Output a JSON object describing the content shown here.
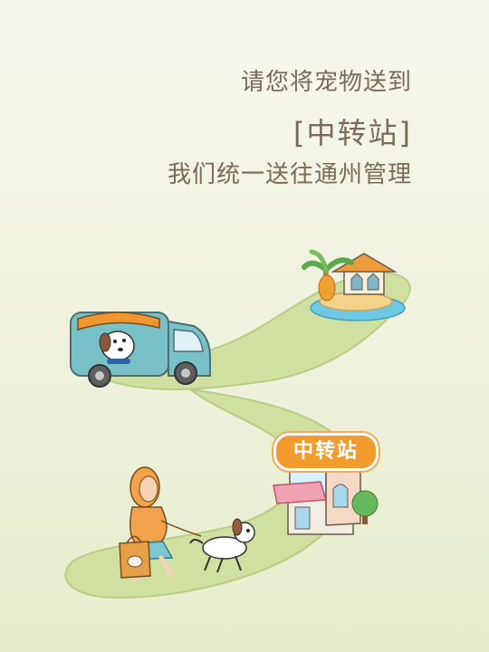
{
  "headline": {
    "line1": "请您将宠物送到",
    "line2": "[中转站]",
    "line3": "我们统一送往通州管理"
  },
  "badge": {
    "label": "中转站"
  },
  "icons": [
    "van-icon",
    "dog-icon",
    "island-hut-icon",
    "palm-tree-icon",
    "shop-icon",
    "tree-icon",
    "woman-walking-icon",
    "bag-icon"
  ],
  "colors": {
    "path": "#cfe0a0",
    "path_edge": "#b9cd85",
    "text": "#7a6a5a",
    "badge": "#f39c2d",
    "van": "#78c1c8",
    "water": "#6fc7e6"
  }
}
